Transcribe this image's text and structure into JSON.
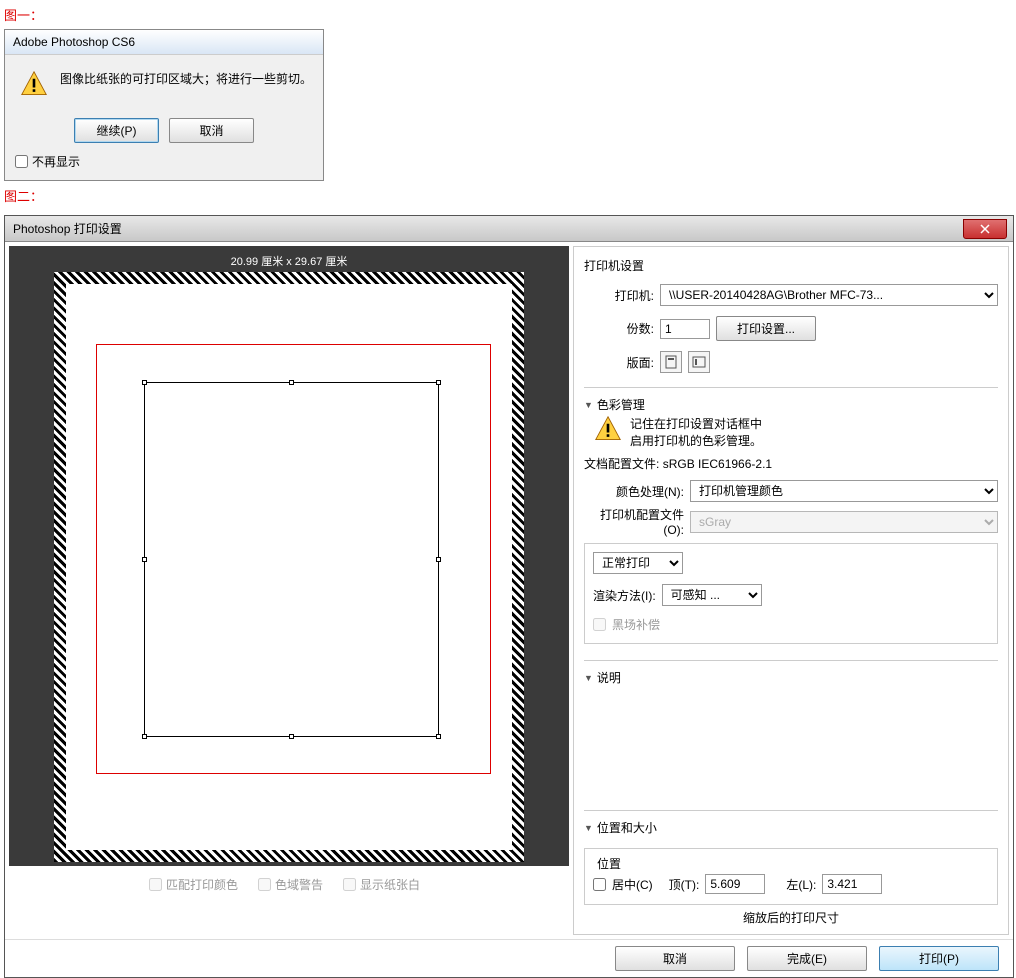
{
  "figure1_label": "图一：",
  "figure2_label": "图二：",
  "dialog1": {
    "title": "Adobe Photoshop CS6",
    "message": "图像比纸张的可打印区域大；将进行一些剪切。",
    "continue_btn": "继续(P)",
    "cancel_btn": "取消",
    "dont_show": "不再显示"
  },
  "dialog2": {
    "title": "Photoshop 打印设置",
    "preview_dims": "20.99 厘米 x 29.67 厘米",
    "match_colors": "匹配打印颜色",
    "gamut_warn": "色域警告",
    "show_white": "显示纸张白",
    "printer_settings_title": "打印机设置",
    "printer_label": "打印机:",
    "printer_value": "\\\\USER-20140428AG\\Brother MFC-73...",
    "copies_label": "份数:",
    "copies_value": "1",
    "print_setup_btn": "打印设置...",
    "layout_label": "版面:",
    "color_mgmt_title": "色彩管理",
    "color_mgmt_msg1": "记住在打印设置对话框中",
    "color_mgmt_msg2": "启用打印机的色彩管理。",
    "doc_profile_label": "文档配置文件:",
    "doc_profile_value": "sRGB IEC61966-2.1",
    "color_handle_label": "颜色处理(N):",
    "color_handle_value": "打印机管理颜色",
    "printer_profile_label": "打印机配置文件(O):",
    "printer_profile_value": "sGray",
    "normal_print": "正常打印",
    "render_label": "渲染方法(I):",
    "render_value": "可感知 ...",
    "black_point": "黑场补偿",
    "desc_title": "说明",
    "position_title": "位置和大小",
    "position_sub": "位置",
    "center_label": "居中(C)",
    "top_label": "顶(T):",
    "top_value": "5.609",
    "left_label": "左(L):",
    "left_value": "3.421",
    "scaled_size_label": "缩放后的打印尺寸",
    "cancel_btn": "取消",
    "done_btn": "完成(E)",
    "print_btn": "打印(P)"
  }
}
